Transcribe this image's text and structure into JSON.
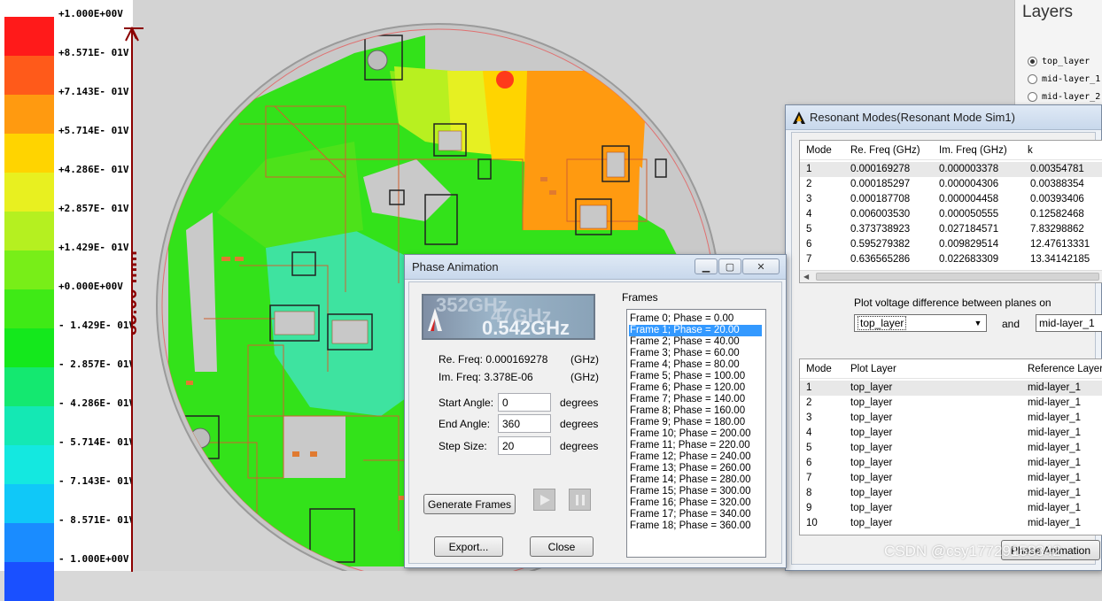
{
  "legend": {
    "colors": [
      "#ff1a1a",
      "#ff5a1a",
      "#ff9a10",
      "#ffd400",
      "#e8f020",
      "#b5f020",
      "#78ee18",
      "#3fea16",
      "#14e81c",
      "#14e870",
      "#14e8b4",
      "#14e8e0",
      "#10c8f8",
      "#1a8cff",
      "#1a50ff"
    ],
    "labels": [
      "+1.000E+00V",
      "+8.571E- 01V",
      "+7.143E- 01V",
      "+5.714E- 01V",
      "+4.286E- 01V",
      "+2.857E- 01V",
      "+1.429E- 01V",
      "+0.000E+00V",
      "- 1.429E- 01V",
      "- 2.857E- 01V",
      "- 4.286E- 01V",
      "- 5.714E- 01V",
      "- 7.143E- 01V",
      "- 8.571E- 01V",
      "- 1.000E+00V"
    ]
  },
  "dimension": {
    "label": "85.00 mm"
  },
  "watermark": "CSDN @csy17729158342",
  "layers_panel": {
    "title": "Layers",
    "items": [
      {
        "label": "top_layer",
        "selected": true
      },
      {
        "label": "mid-layer_1",
        "selected": false
      },
      {
        "label": "mid-layer_2",
        "selected": false
      }
    ]
  },
  "resonant": {
    "title": "Resonant Modes(Resonant Mode Sim1)",
    "columns": [
      "Mode",
      "Re. Freq (GHz)",
      "Im. Freq (GHz)",
      "k"
    ],
    "rows": [
      [
        "1",
        "0.000169278",
        "0.000003378",
        "0.00354781"
      ],
      [
        "2",
        "0.000185297",
        "0.000004306",
        "0.00388354"
      ],
      [
        "3",
        "0.000187708",
        "0.000004458",
        "0.00393406"
      ],
      [
        "4",
        "0.006003530",
        "0.000050555",
        "0.12582468"
      ],
      [
        "5",
        "0.373738923",
        "0.027184571",
        "7.83298862"
      ],
      [
        "6",
        "0.595279382",
        "0.009829514",
        "12.47613331"
      ],
      [
        "7",
        "0.636565286",
        "0.022683309",
        "13.34142185"
      ]
    ],
    "plot_label": "Plot voltage difference between planes on",
    "plot_layer": "top_layer",
    "and_label": "and",
    "ref_layer": "mid-layer_1",
    "pair_columns": [
      "Mode",
      "Plot Layer",
      "Reference Layer"
    ],
    "pairs": [
      [
        "1",
        "top_layer",
        "mid-layer_1"
      ],
      [
        "2",
        "top_layer",
        "mid-layer_1"
      ],
      [
        "3",
        "top_layer",
        "mid-layer_1"
      ],
      [
        "4",
        "top_layer",
        "mid-layer_1"
      ],
      [
        "5",
        "top_layer",
        "mid-layer_1"
      ],
      [
        "6",
        "top_layer",
        "mid-layer_1"
      ],
      [
        "7",
        "top_layer",
        "mid-layer_1"
      ],
      [
        "8",
        "top_layer",
        "mid-layer_1"
      ],
      [
        "9",
        "top_layer",
        "mid-layer_1"
      ],
      [
        "10",
        "top_layer",
        "mid-layer_1"
      ]
    ],
    "phase_button": "Phase Animation"
  },
  "phase": {
    "title": "Phase Animation",
    "preview_text": [
      "352GHz",
      "47GHz",
      "0.542GHz"
    ],
    "re_label": "Re. Freq: 0.000169278",
    "im_label": "Im. Freq: 3.378E-06",
    "unit": "(GHz)",
    "start_label": "Start Angle:",
    "start_value": "0",
    "end_label": "End Angle:",
    "end_value": "360",
    "step_label": "Step Size:",
    "step_value": "20",
    "degrees": "degrees",
    "frames_label": "Frames",
    "frames": [
      "Frame 0; Phase = 0.00",
      "Frame 1; Phase = 20.00",
      "Frame 2; Phase = 40.00",
      "Frame 3; Phase = 60.00",
      "Frame 4; Phase = 80.00",
      "Frame 5; Phase = 100.00",
      "Frame 6; Phase = 120.00",
      "Frame 7; Phase = 140.00",
      "Frame 8; Phase = 160.00",
      "Frame 9; Phase = 180.00",
      "Frame 10; Phase = 200.00",
      "Frame 11; Phase = 220.00",
      "Frame 12; Phase = 240.00",
      "Frame 13; Phase = 260.00",
      "Frame 14; Phase = 280.00",
      "Frame 15; Phase = 300.00",
      "Frame 16; Phase = 320.00",
      "Frame 17; Phase = 340.00",
      "Frame 18; Phase = 360.00"
    ],
    "selected_frame": 1,
    "generate": "Generate Frames",
    "export": "Export...",
    "close": "Close",
    "min_icon": "minimize-icon",
    "max_icon": "maximize-icon",
    "close_icon": "close-icon"
  }
}
